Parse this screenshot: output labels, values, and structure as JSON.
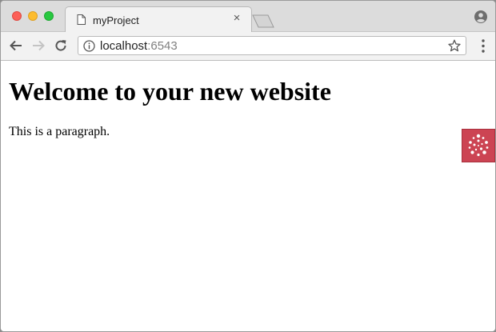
{
  "browser": {
    "tab": {
      "title": "myProject",
      "close_glyph": "×",
      "icon": "page-icon"
    },
    "address_bar": {
      "host": "localhost",
      "port": ":6543",
      "info_icon": "info-icon"
    }
  },
  "page": {
    "heading": "Welcome to your new website",
    "paragraph": "This is a paragraph."
  },
  "widget": {
    "icon": "radial-dots-icon",
    "color": "#cc4453"
  },
  "colors": {
    "close": "#fc5f57",
    "minimize": "#fdbc2e",
    "maximize": "#28c840"
  }
}
